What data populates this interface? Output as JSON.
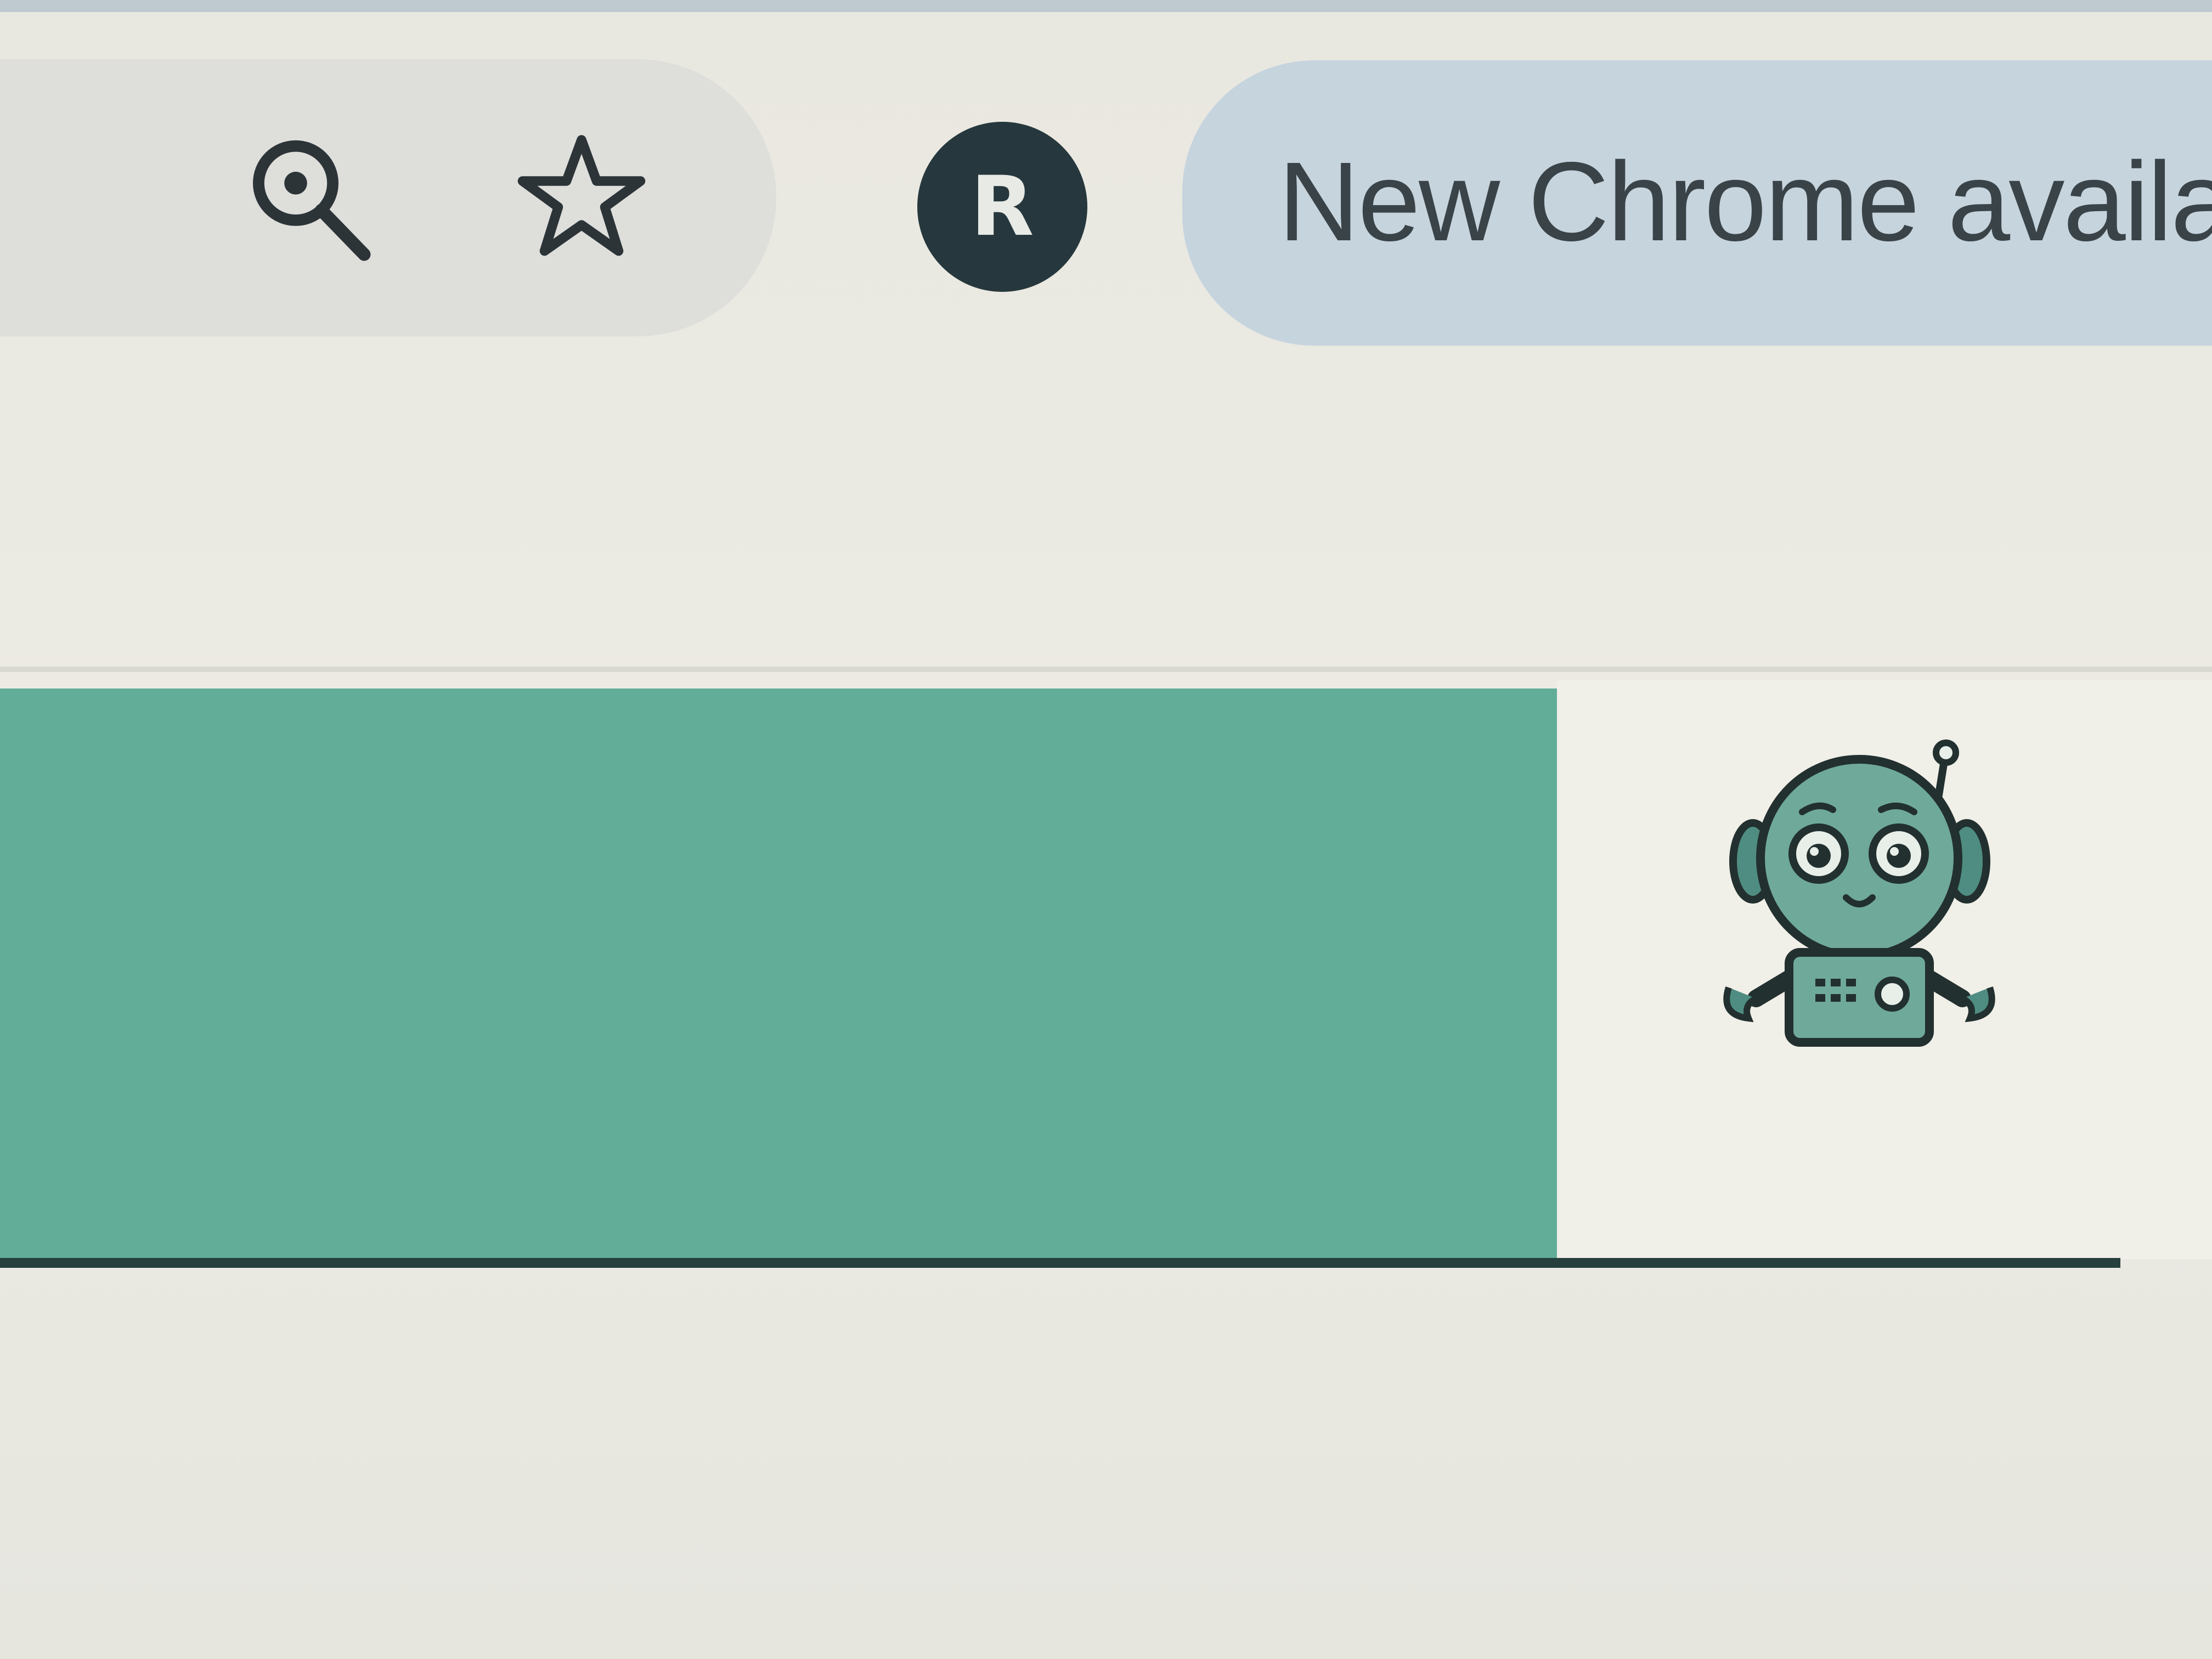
{
  "toolbar": {
    "zoom_icon": "zoom-in-icon",
    "bookmark_icon": "star-outline-icon",
    "profile_initial": "R",
    "update_label": "New Chrome available"
  },
  "banner": {
    "mascot_icon": "robot-mascot-icon"
  },
  "colors": {
    "banner": "#62ad98",
    "avatar": "#26383d",
    "update_pill": "#c6d4de",
    "background": "#ecebe4",
    "underline": "#26403e"
  }
}
